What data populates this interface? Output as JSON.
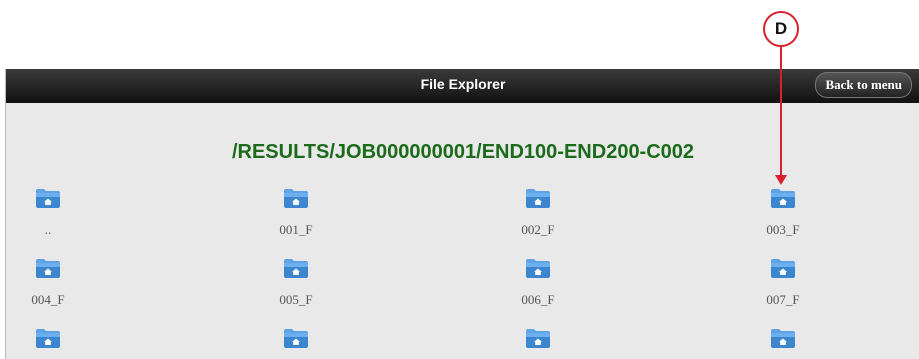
{
  "annotation": {
    "callout_label": "D"
  },
  "app": {
    "title": "File Explorer",
    "back_label": "Back to menu"
  },
  "current_path": "/RESULTS/JOB000000001/END100-END200-C002",
  "items": [
    {
      "label": "..",
      "icon": "folder-home-icon"
    },
    {
      "label": "001_F",
      "icon": "folder-home-icon"
    },
    {
      "label": "002_F",
      "icon": "folder-home-icon"
    },
    {
      "label": "003_F",
      "icon": "folder-home-icon"
    },
    {
      "label": "004_F",
      "icon": "folder-home-icon"
    },
    {
      "label": "005_F",
      "icon": "folder-home-icon"
    },
    {
      "label": "006_F",
      "icon": "folder-home-icon"
    },
    {
      "label": "007_F",
      "icon": "folder-home-icon"
    },
    {
      "label": "",
      "icon": "folder-home-icon"
    },
    {
      "label": "",
      "icon": "folder-home-icon"
    },
    {
      "label": "",
      "icon": "folder-home-icon"
    },
    {
      "label": "",
      "icon": "folder-home-icon"
    }
  ],
  "colors": {
    "path_text": "#1b6b1b",
    "callout": "#d8212d",
    "folder": "#3b86cf",
    "titlebar": "#111111"
  }
}
